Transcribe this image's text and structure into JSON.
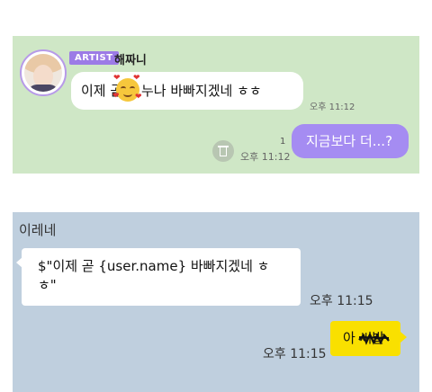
{
  "panel1": {
    "badge": "ARTIST",
    "sender": "해짜니",
    "message_before": "이제 곧",
    "message_after": "누나 바빠지겠네 ㅎㅎ",
    "message_time": "오후 11:12",
    "read_count": "1",
    "reply_time": "오후 11:12",
    "reply": "지금보다 더...?"
  },
  "panel2": {
    "sender": "이레네",
    "message": "$\"이제 곧 {user.name} 바빠지겠네 ㅎㅎ\"",
    "message_time": "오후 11:15",
    "reply_time": "오후 11:15",
    "reply_prefix": "아",
    "reply_scribbled": "씨발"
  },
  "colors": {
    "panel1_bg": "#cfe7c6",
    "panel2_bg": "#bfcfde",
    "artist_badge": "#9c7be6",
    "purple_bubble": "#a58cf2",
    "yellow_bubble": "#f9e000"
  },
  "icons": [
    "trash-icon",
    "heart-eyes-emoji"
  ]
}
